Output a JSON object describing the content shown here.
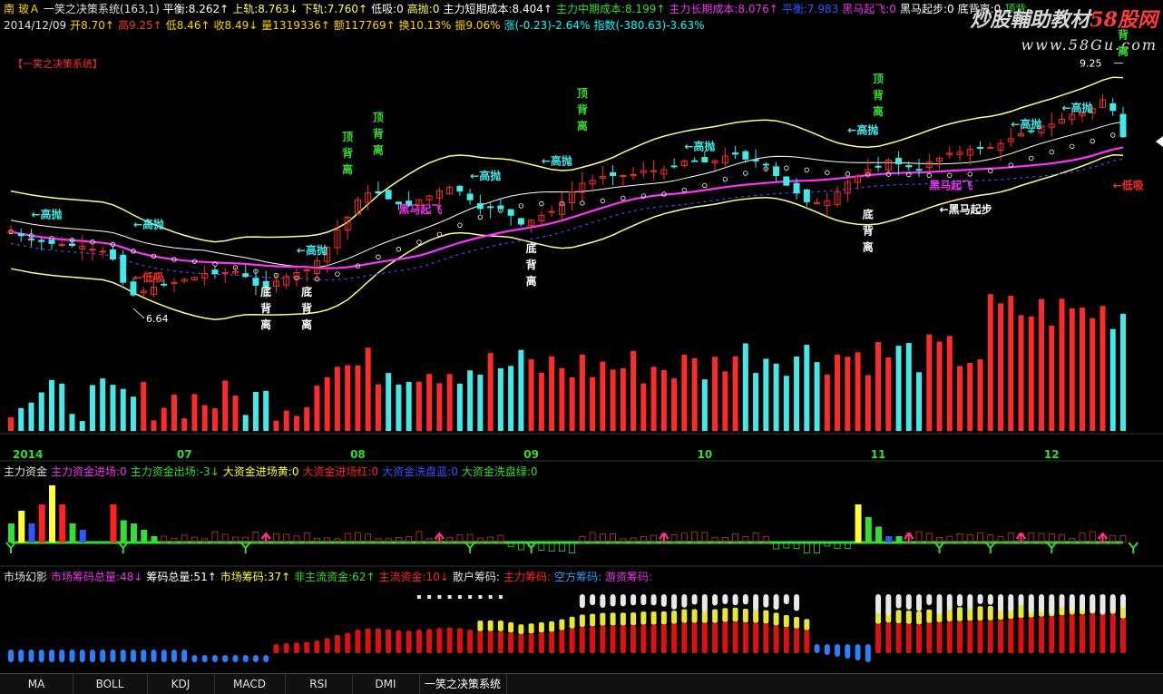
{
  "header": {
    "row1": [
      {
        "t": "南",
        "c": "#ffd200"
      },
      {
        "t": "玻Ａ",
        "c": "#ffd200"
      },
      {
        "t": "一笑之决策系统(163,1)",
        "c": "#e0e0e0"
      },
      {
        "t": "平衡:8.262↑",
        "c": "#ffffff"
      },
      {
        "t": "上轨:8.763↓",
        "c": "#ffff66"
      },
      {
        "t": "下轨:7.760↑",
        "c": "#ffff66"
      },
      {
        "t": "低吸:0",
        "c": "#ffffff"
      },
      {
        "t": "高抛:0",
        "c": "#ffff66"
      },
      {
        "t": "主力短期成本:8.404↑",
        "c": "#ffffff"
      },
      {
        "t": "主力中期成本:8.199↑",
        "c": "#33dd33"
      },
      {
        "t": "主力长期成本:8.076↑",
        "c": "#ee33ee"
      },
      {
        "t": "平衡:7.983",
        "c": "#3355ff"
      },
      {
        "t": "黑马起飞:0",
        "c": "#ee33ee"
      },
      {
        "t": "黑马起步:0",
        "c": "#ffffff"
      },
      {
        "t": "底背离:0",
        "c": "#ffffff"
      },
      {
        "t": "顶背",
        "c": "#33dd33"
      }
    ],
    "row2": [
      {
        "t": "2014/12/09",
        "c": "#e0e0e0"
      },
      {
        "t": "开8.70↑",
        "c": "#ffd200"
      },
      {
        "t": "高9.25↑",
        "c": "#ff3333"
      },
      {
        "t": "低8.46↑",
        "c": "#ffd200"
      },
      {
        "t": "收8.49↓",
        "c": "#ffd200"
      },
      {
        "t": "量1319336↑",
        "c": "#ffd200"
      },
      {
        "t": "额117769↑",
        "c": "#ffd200"
      },
      {
        "t": "换10.13%",
        "c": "#ffd200"
      },
      {
        "t": "振9.06%",
        "c": "#ffd200"
      },
      {
        "t": "涨(-0.23)-2.64%",
        "c": "#00ffff"
      },
      {
        "t": "指数(-380.63)-3.63%",
        "c": "#00ffff"
      }
    ],
    "panel_label": "【一笑之决策系统】"
  },
  "watermark": {
    "line1": "炒股輔助教材",
    "line1b": "58股网",
    "line2": "www.58Gu.com"
  },
  "indicator1": {
    "labels": [
      {
        "t": "主力资金",
        "c": "#e0e0e0"
      },
      {
        "t": "主力资金进场:0",
        "c": "#ee33ee"
      },
      {
        "t": "主力资金出场:-3↓",
        "c": "#33dd33"
      },
      {
        "t": "大资金进场黄:0",
        "c": "#ffff33"
      },
      {
        "t": "大资金进场红:0",
        "c": "#ff2222"
      },
      {
        "t": "大资金洗盘蓝:0",
        "c": "#3355ff"
      },
      {
        "t": "大资金洗盘绿:0",
        "c": "#33dd33"
      }
    ]
  },
  "indicator2": {
    "labels": [
      {
        "t": "市场幻影",
        "c": "#e0e0e0"
      },
      {
        "t": "市场筹码总量:48↓",
        "c": "#ee33ee"
      },
      {
        "t": "筹码总量:51↑",
        "c": "#ffffff"
      },
      {
        "t": "市场筹码:37↑",
        "c": "#ffff33"
      },
      {
        "t": "非主流资金:62↑",
        "c": "#33dd33"
      },
      {
        "t": "主流资金:10↓",
        "c": "#ff2222"
      },
      {
        "t": "散户筹码:",
        "c": "#e0e0e0"
      },
      {
        "t": "主力筹码:",
        "c": "#ff2222"
      },
      {
        "t": "空方筹码:",
        "c": "#3399ff"
      },
      {
        "t": "游资筹码:",
        "c": "#ee33ee"
      }
    ]
  },
  "tabs": [
    "MA",
    "BOLL",
    "KDJ",
    "MACD",
    "RSI",
    "DMI",
    "一笑之决策系统"
  ],
  "colors": {
    "up": "#ff2a2a",
    "down": "#44e8e8",
    "band": "#ffff88",
    "cost": "#ff33ff",
    "white": "#ffffff",
    "green": "#33dd33"
  },
  "chart_data": {
    "type": "candlestick",
    "x_labels": [
      "2014",
      "07",
      "08",
      "09",
      "10",
      "11",
      "12"
    ],
    "x_label_index": [
      0,
      17,
      34,
      51,
      68,
      85,
      102
    ],
    "price_ylim": [
      6.3,
      9.45
    ],
    "high_label": "9.25",
    "low_label": "6.64",
    "low_index": 12,
    "closes": [
      7.51,
      7.47,
      7.43,
      7.41,
      7.39,
      7.38,
      7.37,
      7.36,
      7.33,
      7.31,
      7.23,
      6.99,
      6.86,
      6.9,
      6.94,
      6.97,
      6.99,
      7.02,
      7.04,
      7.08,
      7.08,
      7.09,
      7.1,
      7.05,
      6.96,
      6.93,
      7.0,
      7.05,
      7.09,
      7.12,
      7.21,
      7.35,
      7.53,
      7.66,
      7.84,
      7.91,
      7.91,
      7.85,
      7.8,
      7.78,
      7.84,
      7.88,
      7.93,
      7.97,
      7.93,
      7.84,
      7.75,
      7.76,
      7.75,
      7.68,
      7.59,
      7.63,
      7.68,
      7.72,
      7.81,
      7.92,
      8.01,
      8.04,
      8.08,
      8.09,
      8.09,
      8.1,
      8.14,
      8.14,
      8.15,
      8.18,
      8.24,
      8.24,
      8.23,
      8.24,
      8.29,
      8.31,
      8.26,
      8.24,
      8.2,
      8.09,
      7.99,
      7.91,
      7.82,
      7.81,
      7.83,
      7.92,
      8.02,
      8.08,
      8.15,
      8.18,
      8.25,
      8.21,
      8.18,
      8.15,
      8.23,
      8.27,
      8.32,
      8.33,
      8.36,
      8.37,
      8.38,
      8.42,
      8.47,
      8.52,
      8.55,
      8.6,
      8.62,
      8.67,
      8.72,
      8.73,
      8.78,
      8.87,
      8.76,
      8.49
    ],
    "signals": [
      {
        "text": "←高抛",
        "i": 2,
        "p": 7.65,
        "c": "#44e8e8"
      },
      {
        "text": "←高抛",
        "i": 12,
        "p": 7.55,
        "c": "#44e8e8"
      },
      {
        "text": "←高抛",
        "i": 28,
        "p": 7.28,
        "c": "#44e8e8"
      },
      {
        "text": "←高抛",
        "i": 45,
        "p": 8.05,
        "c": "#44e8e8"
      },
      {
        "text": "←高抛",
        "i": 52,
        "p": 8.2,
        "c": "#44e8e8"
      },
      {
        "text": "←高抛",
        "i": 66,
        "p": 8.35,
        "c": "#44e8e8"
      },
      {
        "text": "←高抛",
        "i": 82,
        "p": 8.52,
        "c": "#44e8e8"
      },
      {
        "text": "←高抛",
        "i": 98,
        "p": 8.58,
        "c": "#44e8e8"
      },
      {
        "text": "←高抛",
        "i": 103,
        "p": 8.75,
        "c": "#44e8e8"
      },
      {
        "text": "←低吸",
        "i": 12,
        "p": 7.0,
        "c": "#ff2a2a"
      },
      {
        "text": "←低吸",
        "i": 108,
        "p": 7.95,
        "c": "#ff2a2a"
      },
      {
        "text": "黑马起飞",
        "i": 38,
        "p": 7.7,
        "c": "#ee33ee"
      },
      {
        "text": "黑马起飞",
        "i": 90,
        "p": 7.95,
        "c": "#ee33ee"
      },
      {
        "text": "←黑马起步",
        "i": 91,
        "p": 7.7,
        "c": "#ffffff"
      },
      {
        "text": "顶背离",
        "i": 33,
        "p": 8.45,
        "c": "#33dd33",
        "v": 1
      },
      {
        "text": "顶背离",
        "i": 36,
        "p": 8.65,
        "c": "#33dd33",
        "v": 1
      },
      {
        "text": "顶背离",
        "i": 56,
        "p": 8.9,
        "c": "#33dd33",
        "v": 1
      },
      {
        "text": "顶背离",
        "i": 85,
        "p": 9.05,
        "c": "#33dd33",
        "v": 1
      },
      {
        "text": "背离",
        "i": 109,
        "p": 9.5,
        "c": "#33dd33",
        "v": 1
      },
      {
        "text": "底背离",
        "i": 25,
        "p": 6.85,
        "c": "#ffffff",
        "v": 1
      },
      {
        "text": "底背离",
        "i": 29,
        "p": 6.85,
        "c": "#ffffff",
        "v": 1
      },
      {
        "text": "底背离",
        "i": 51,
        "p": 7.3,
        "c": "#ffffff",
        "v": 1
      },
      {
        "text": "底背离",
        "i": 84,
        "p": 7.65,
        "c": "#ffffff",
        "v": 1
      }
    ]
  }
}
